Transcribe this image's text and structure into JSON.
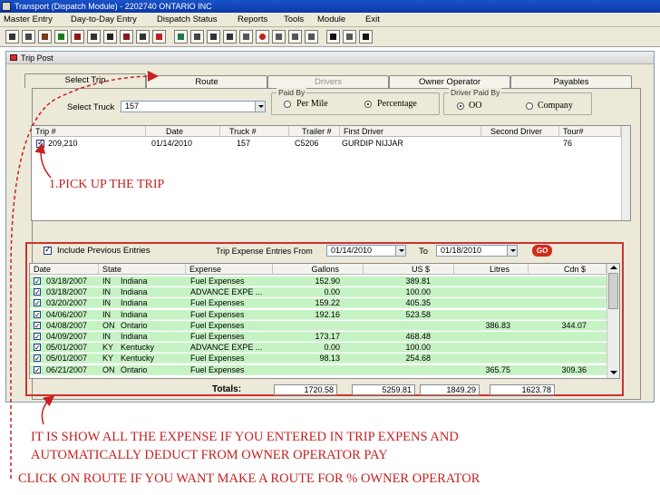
{
  "window": {
    "title": "Transport (Dispatch Module) - 2202740 ONTARIO INC"
  },
  "menu": [
    "Master Entry",
    "Day-to-Day Entry",
    "Dispatch Status",
    "Reports",
    "Tools",
    "Module",
    "Exit"
  ],
  "inner_window": {
    "title": "Trip Post"
  },
  "tabs": [
    "Select Trip",
    "Route",
    "Drivers",
    "Owner Operator",
    "Payables"
  ],
  "select_truck": {
    "label": "Select Truck",
    "value": "157"
  },
  "paid_by": {
    "legend": "Paid By",
    "options": [
      "Per Mile",
      "Percentage"
    ],
    "selected": "Percentage"
  },
  "driver_paid_by": {
    "legend": "Driver Paid By",
    "options": [
      "OO",
      "Company"
    ],
    "selected": "OO"
  },
  "trip_grid": {
    "headers": [
      "Trip #",
      "Date",
      "Truck #",
      "Trailer #",
      "First Driver",
      "Second Driver",
      "Tour#"
    ],
    "rows": [
      {
        "trip": "209,210",
        "date": "01/14/2010",
        "truck": "157",
        "trailer": "C5206",
        "first_driver": "GURDIP NIJJAR",
        "second_driver": "",
        "tour": "76"
      }
    ]
  },
  "expense": {
    "include_previous_label": "Include Previous Entries",
    "from_label": "Trip Expense Entries From",
    "from_value": "01/14/2010",
    "to_label": "To",
    "to_value": "01/18/2010",
    "go_label": "GO",
    "headers": [
      "Date",
      "State",
      "Expense",
      "Gallons",
      "US $",
      "Litres",
      "Cdn $"
    ],
    "rows": [
      {
        "date": "03/18/2007",
        "code": "IN",
        "state": "Indiana",
        "expense": "Fuel Expenses",
        "gallons": "152.90",
        "us": "389.81",
        "litres": "",
        "cdn": ""
      },
      {
        "date": "03/18/2007",
        "code": "IN",
        "state": "Indiana",
        "expense": "ADVANCE EXPE ...",
        "gallons": "0.00",
        "us": "100.00",
        "litres": "",
        "cdn": ""
      },
      {
        "date": "03/20/2007",
        "code": "IN",
        "state": "Indiana",
        "expense": "Fuel Expenses",
        "gallons": "159.22",
        "us": "405.35",
        "litres": "",
        "cdn": ""
      },
      {
        "date": "04/06/2007",
        "code": "IN",
        "state": "Indiana",
        "expense": "Fuel Expenses",
        "gallons": "192.16",
        "us": "523.58",
        "litres": "",
        "cdn": ""
      },
      {
        "date": "04/08/2007",
        "code": "ON",
        "state": "Ontario",
        "expense": "Fuel Expenses",
        "gallons": "",
        "us": "",
        "litres": "386.83",
        "cdn": "344.07"
      },
      {
        "date": "04/09/2007",
        "code": "IN",
        "state": "Indiana",
        "expense": "Fuel Expenses",
        "gallons": "173.17",
        "us": "468.48",
        "litres": "",
        "cdn": ""
      },
      {
        "date": "05/01/2007",
        "code": "KY",
        "state": "Kentucky",
        "expense": "ADVANCE EXPE ...",
        "gallons": "0.00",
        "us": "100.00",
        "litres": "",
        "cdn": ""
      },
      {
        "date": "05/01/2007",
        "code": "KY",
        "state": "Kentucky",
        "expense": "Fuel Expenses",
        "gallons": "98.13",
        "us": "254.68",
        "litres": "",
        "cdn": ""
      },
      {
        "date": "06/21/2007",
        "code": "ON",
        "state": "Ontario",
        "expense": "Fuel Expenses",
        "gallons": "",
        "us": "",
        "litres": "365.75",
        "cdn": "309.36"
      }
    ],
    "totals_label": "Totals:",
    "totals": {
      "gallons": "1720.58",
      "us": "5259.81",
      "litres": "1849.29",
      "cdn": "1623.78"
    }
  },
  "annotations": {
    "pick_trip": "1.PICK UP THE  TRIP",
    "note_line1": "IT IS SHOW ALL THE EXPENSE IF YOU ENTERED IN TRIP EXPENS AND",
    "note_line2": "AUTOMATICALLY DEDUCT FROM OWNER OPERATOR PAY",
    "route_hint": "CLICK ON ROUTE IF YOU WANT  MAKE A ROUTE FOR % OWNER OPERATOR"
  },
  "colors": {
    "title_bar": "#1a52c8",
    "annotation": "#c62020",
    "expense_row": "#c6f3c4",
    "go_button": "#d42a1c"
  }
}
